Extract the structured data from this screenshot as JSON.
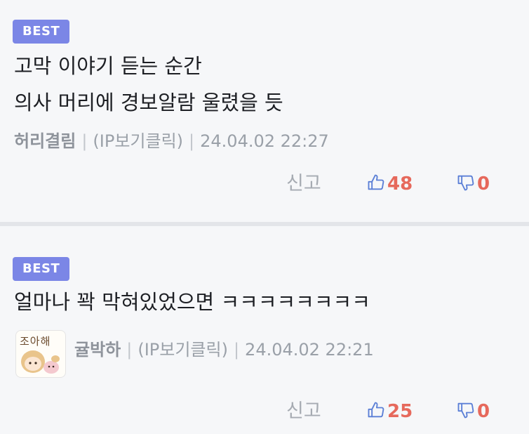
{
  "comments": [
    {
      "badge": "BEST",
      "lines": [
        "고막 이야기 듣는 순간",
        "의사 머리에 경보알람 울렸을 듯"
      ],
      "nickname": "허리결림",
      "ip": "(IP보기클릭)",
      "datetime": "24.04.02 22:27",
      "report_label": "신고",
      "likes": "48",
      "dislikes": "0"
    },
    {
      "badge": "BEST",
      "lines": [
        "얼마나 꽉 막혀있었으면 ㅋㅋㅋㅋㅋㅋㅋㅋ"
      ],
      "avatar_text": "조아해",
      "nickname": "귤박하",
      "ip": "(IP보기클릭)",
      "datetime": "24.04.02 22:21",
      "report_label": "신고",
      "likes": "25",
      "dislikes": "0"
    }
  ],
  "separator": "|",
  "icons": {
    "like": "thumbs-up-icon",
    "dislike": "thumbs-down-icon"
  },
  "colors": {
    "badge_bg": "#7b86e6",
    "thumb_icon": "#5b7fd6",
    "count": "#e6695c",
    "meta": "#9aa0a8"
  }
}
